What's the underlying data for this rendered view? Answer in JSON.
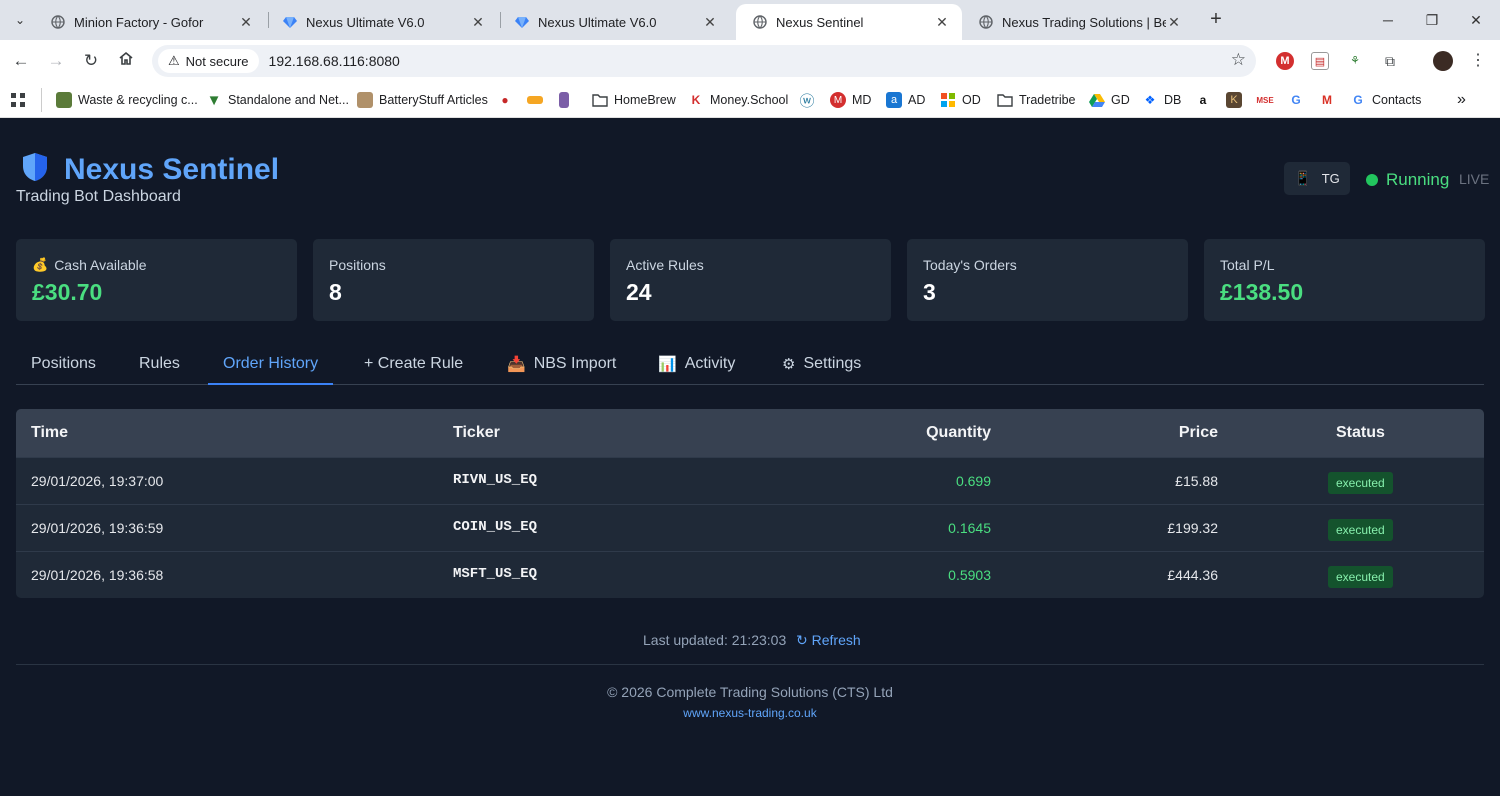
{
  "browser": {
    "tabs": [
      {
        "title": "Minion Factory - Gofor",
        "icon": "globe-icon"
      },
      {
        "title": "Nexus Ultimate V6.0",
        "icon": "gem-icon"
      },
      {
        "title": "Nexus Ultimate V6.0",
        "icon": "gem-icon"
      },
      {
        "title": "Nexus Sentinel",
        "icon": "globe-icon",
        "active": true
      },
      {
        "title": "Nexus Trading Solutions | Begin",
        "icon": "globe-icon"
      }
    ],
    "security_label": "Not secure",
    "url": "192.168.68.116:8080",
    "bookmarks": [
      {
        "label": "Waste & recycling c...",
        "icon": "leaf-icon"
      },
      {
        "label": "Standalone and Net...",
        "icon": "triangle-icon"
      },
      {
        "label": "BatteryStuff Articles",
        "icon": "battery-icon"
      },
      {
        "label": "",
        "icon": "red-circle-icon"
      },
      {
        "label": "",
        "icon": "stripe-icon"
      },
      {
        "label": "",
        "icon": "bag-icon"
      },
      {
        "label": "HomeBrew",
        "icon": "folder-icon"
      },
      {
        "label": "Money.School",
        "icon": "k-icon"
      },
      {
        "label": "",
        "icon": "wordpress-icon"
      },
      {
        "label": "MD",
        "icon": "m-circle-icon"
      },
      {
        "label": "AD",
        "icon": "a-square-icon"
      },
      {
        "label": "OD",
        "icon": "windows-icon"
      },
      {
        "label": "Tradetribe",
        "icon": "folder-icon"
      },
      {
        "label": "GD",
        "icon": "drive-icon"
      },
      {
        "label": "DB",
        "icon": "dropbox-icon"
      },
      {
        "label": "",
        "icon": "amazon-icon"
      },
      {
        "label": "",
        "icon": "k-square-icon"
      },
      {
        "label": "",
        "icon": "mse-icon"
      },
      {
        "label": "",
        "icon": "google-icon"
      },
      {
        "label": "",
        "icon": "gmail-icon"
      },
      {
        "label": "Contacts",
        "icon": "google-icon"
      }
    ]
  },
  "app": {
    "title": "Nexus Sentinel",
    "subtitle": "Trading Bot Dashboard",
    "tg_label": "TG",
    "status": "Running",
    "mode": "LIVE",
    "accent": "#60a5fa",
    "positive_color": "#4ade80"
  },
  "cards": [
    {
      "label": "Cash Available",
      "value": "£30.70",
      "icon": "money-bag-icon",
      "green": true
    },
    {
      "label": "Positions",
      "value": "8"
    },
    {
      "label": "Active Rules",
      "value": "24"
    },
    {
      "label": "Today's Orders",
      "value": "3"
    },
    {
      "label": "Total P/L",
      "value": "£138.50",
      "green": true
    }
  ],
  "tabs": [
    {
      "label": "Positions"
    },
    {
      "label": "Rules"
    },
    {
      "label": "Order History",
      "active": true
    },
    {
      "label": "+ Create Rule"
    },
    {
      "label": "NBS Import",
      "icon": "inbox-icon"
    },
    {
      "label": "Activity",
      "icon": "bar-chart-icon"
    },
    {
      "label": "Settings",
      "icon": "gear-icon"
    }
  ],
  "orders": {
    "columns": [
      "Time",
      "Ticker",
      "Quantity",
      "Price",
      "Status"
    ],
    "rows": [
      {
        "time": "29/01/2026, 19:37:00",
        "ticker": "RIVN_US_EQ",
        "quantity": "0.699",
        "price": "£15.88",
        "status": "executed"
      },
      {
        "time": "29/01/2026, 19:36:59",
        "ticker": "COIN_US_EQ",
        "quantity": "0.1645",
        "price": "£199.32",
        "status": "executed"
      },
      {
        "time": "29/01/2026, 19:36:58",
        "ticker": "MSFT_US_EQ",
        "quantity": "0.5903",
        "price": "£444.36",
        "status": "executed"
      }
    ]
  },
  "footer": {
    "last_updated": "Last updated: 21:23:03",
    "refresh_label": "↻ Refresh",
    "copyright": "© 2026 Complete Trading Solutions (CTS) Ltd",
    "website": "www.nexus-trading.co.uk"
  }
}
